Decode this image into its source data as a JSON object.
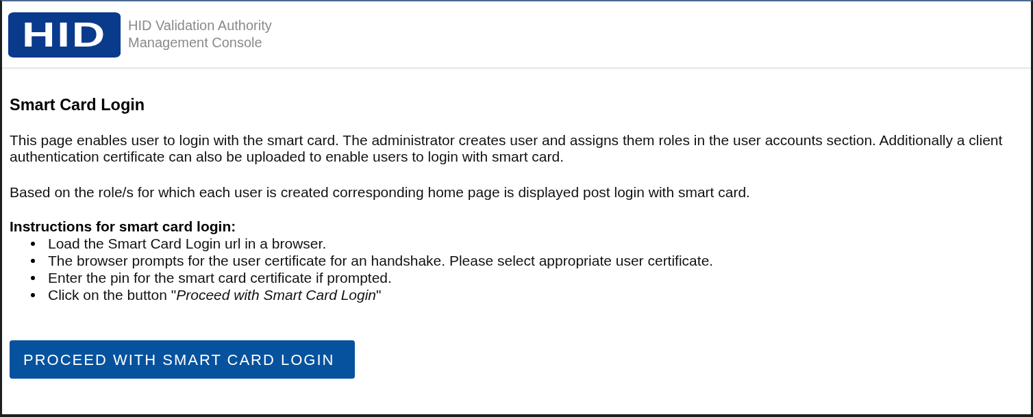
{
  "header": {
    "logo": "HID",
    "title": "HID Validation Authority Management Console"
  },
  "content": {
    "heading": "Smart Card Login",
    "paragraphs": [
      "This page enables user to login with the smart card. The administrator creates user and assigns them roles in the user accounts section. Additionally a client authentication certificate can also be uploaded to enable users to login with smart card.",
      "Based on the role/s for which each user is created corresponding home page is displayed post login with smart card."
    ],
    "instructions": {
      "heading": "Instructions for smart card login:",
      "items": [
        "Load the Smart Card Login url in a browser.",
        "The browser prompts for the user certificate for an handshake. Please select appropriate user certificate.",
        "Enter the pin for the smart card certificate if prompted.",
        "Click on the button \"*Proceed with Smart Card Login*\""
      ]
    }
  },
  "button": {
    "label": "PROCEED WITH SMART CARD LOGIN"
  }
}
